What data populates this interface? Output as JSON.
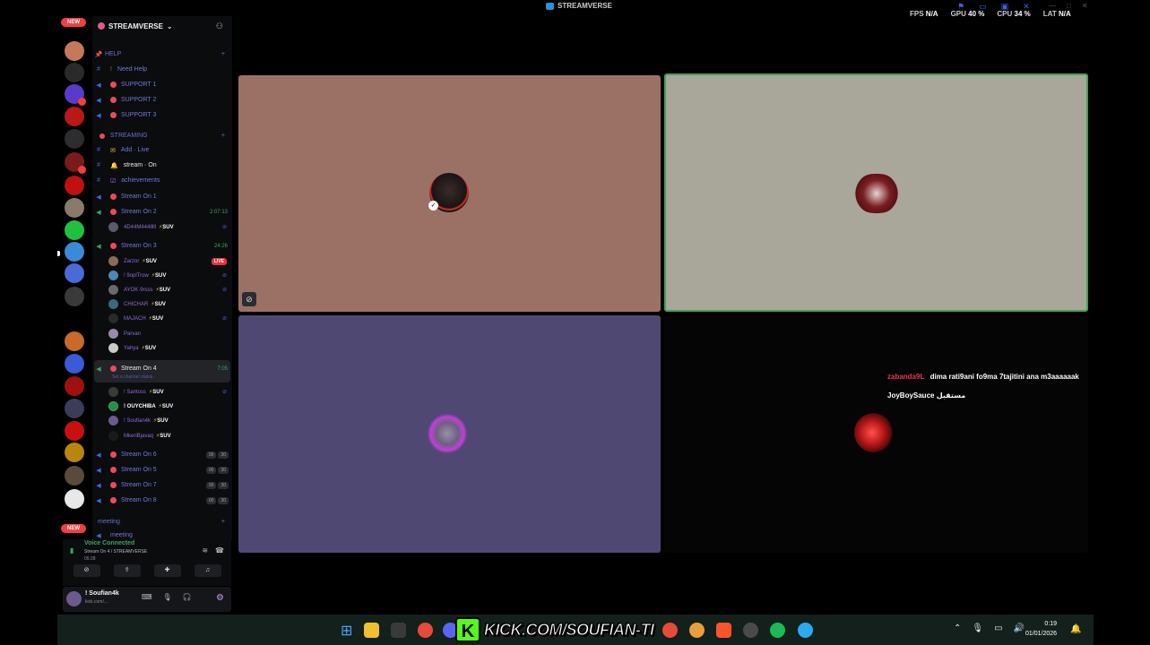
{
  "window": {
    "title": "STREAMVERSE",
    "stats": {
      "fps_label": "FPS",
      "fps": "N/A",
      "gpu_label": "GPU",
      "gpu": "40 %",
      "cpu_label": "CPU",
      "cpu": "34 %",
      "lat_label": "LAT",
      "lat": "N/A"
    }
  },
  "server_rail": {
    "new_label": "NEW"
  },
  "sidebar": {
    "server_name": "STREAMVERSE",
    "help_category": "HELP",
    "channels_help": [
      "Need Help",
      "SUPPORT 1",
      "SUPPORT 2",
      "SUPPORT 3"
    ],
    "streaming_category": "STREAMING",
    "text_channels": [
      "Add · Live",
      "stream · On",
      "achievements"
    ],
    "stream_on_1": "Stream On 1",
    "stream_on_2": "Stream On 2",
    "stream_on_2_timer": "2:07:13",
    "stream_on_2_member": "4D44M444lllll",
    "stream_on_3": "Stream On 3",
    "stream_on_3_timer": "24:26",
    "stream_on_3_members": [
      "Zarzor",
      "! 9oplTrow",
      "AYOK·9rsss",
      "CHICHAR",
      "MAJACH",
      "Parvan",
      "Yahya"
    ],
    "live_label": "LIVE",
    "tag_label": "SUV",
    "stream_on_4": "Stream On 4",
    "stream_on_4_timer": "7:05",
    "set_status": "Set a channel status",
    "stream_on_4_members": [
      "! Santoss",
      "! OUYCHIBA",
      "! Soufian4k",
      "MkeriBjavaq"
    ],
    "stream_on_others": [
      "Stream On 6",
      "Stream On 5",
      "Stream On 7",
      "Stream On 8"
    ],
    "counts": [
      "00",
      "30"
    ],
    "meeting_category": "meeting",
    "meeting_channel": "meeting"
  },
  "voice_panel": {
    "title": "Voice Connected",
    "subtitle": "Stream On 4 / STREAMVERSE",
    "time": "05:28"
  },
  "user_panel": {
    "name": "! Soufian4k",
    "status": "kick.com/..."
  },
  "chat": [
    {
      "user": "zabanda9L",
      "message": "dima rati9ani fo9ma 7tajitini ana m3aaaaaak"
    },
    {
      "user": "JoyBoySauce",
      "message": "مستقبل"
    }
  ],
  "taskbar": {
    "kick_banner": "KICK.COM/SOUFIAN-TI",
    "time": "0:19",
    "date": "01/01/2026"
  },
  "colors": {
    "accent_green": "#3ba55d",
    "live_red": "#e8323c",
    "kick_green": "#53fc18"
  }
}
